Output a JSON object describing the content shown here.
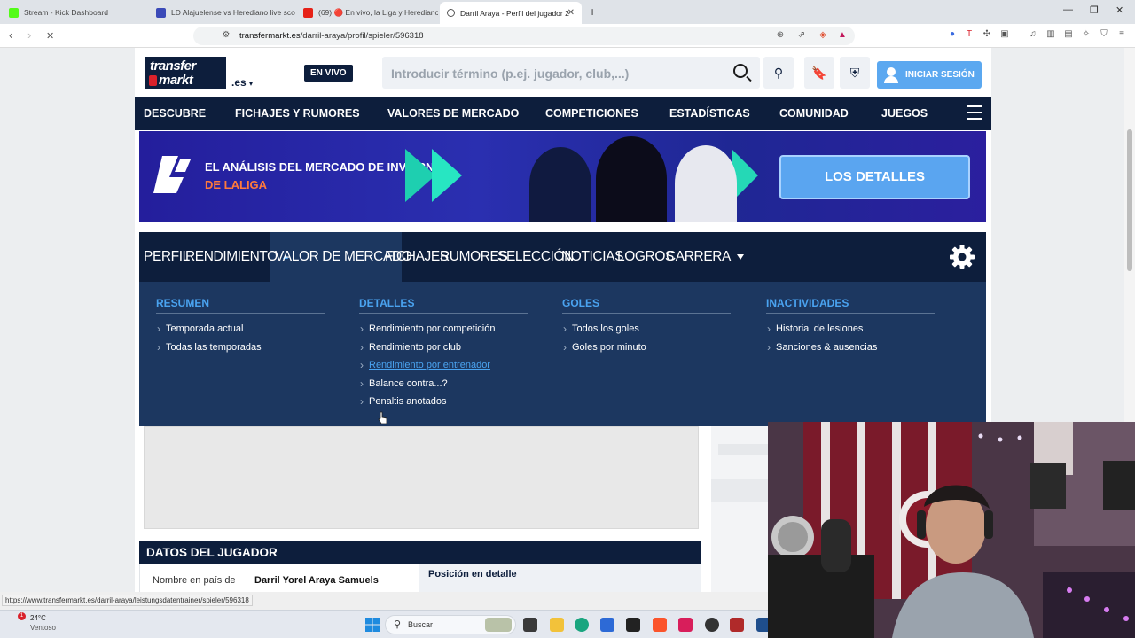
{
  "browser": {
    "tabs": [
      {
        "title": "Stream - Kick Dashboard",
        "favicon_color": "#53fc18"
      },
      {
        "title": "LD Alajuelense vs Herediano live sco",
        "favicon_color": "#3b4ab8"
      },
      {
        "title": "(69) 🔴 En vivo, la Liga y Herediano e",
        "favicon_color": "#e62117"
      },
      {
        "title": "Darril Araya - Perfil del jugador 2",
        "favicon_color": "#555555",
        "active": true
      }
    ],
    "url_host": "transfermarkt.es",
    "url_path": "/darril-araya/profil/spieler/596318",
    "status_url": "https://www.transfermarkt.es/darril-araya/leistungsdatentrainer/spieler/596318"
  },
  "header": {
    "logo_line1": "transfer",
    "logo_line2": "markt",
    "domain": ".es",
    "live_badge": "EN VIVO",
    "search_placeholder": "Introducir término (p.ej. jugador, club,...)",
    "login_label": "INICIAR SESIÓN"
  },
  "main_nav": [
    "DESCUBRE",
    "FICHAJES Y RUMORES",
    "VALORES DE MERCADO",
    "COMPETICIONES",
    "ESTADÍSTICAS",
    "COMUNIDAD",
    "JUEGOS"
  ],
  "banner": {
    "line1": "EL ANÁLISIS DEL MERCADO DE INVIERNO",
    "line2": "DE LALIGA",
    "cta": "LOS DETALLES"
  },
  "profile_nav": [
    "PERFIL",
    "RENDIMIENTO",
    "VALOR DE MERCADO",
    "FICHAJES",
    "RUMORES",
    "SELECCIÓN",
    "NOTICIAS",
    "LOGROS",
    "CARRERA"
  ],
  "dropdown": {
    "columns": [
      {
        "heading": "RESUMEN",
        "links": [
          "Temporada actual",
          "Todas las temporadas"
        ]
      },
      {
        "heading": "DETALLES",
        "links": [
          "Rendimiento por competición",
          "Rendimiento por club",
          "Rendimiento por entrenador",
          "Balance contra...?",
          "Penaltis anotados"
        ]
      },
      {
        "heading": "GOLES",
        "links": [
          "Todos los goles",
          "Goles por minuto"
        ]
      },
      {
        "heading": "INACTIVIDADES",
        "links": [
          "Historial de lesiones",
          "Sanciones & ausencias"
        ]
      }
    ]
  },
  "player_data": {
    "heading": "DATOS DEL JUGADOR",
    "label": "Nombre en país de",
    "value": "Darril Yorel Araya Samuels",
    "position_title": "Posición en detalle"
  },
  "taskbar": {
    "temperature": "24°C",
    "weather": "Ventoso",
    "notification_count": "1",
    "search_label": "Buscar"
  }
}
